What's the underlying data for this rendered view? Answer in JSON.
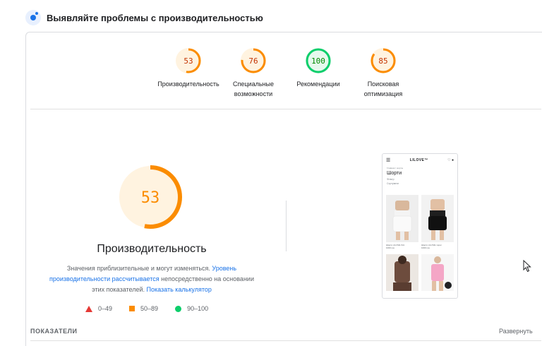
{
  "header": {
    "title": "Выявляйте проблемы с производительностью",
    "icon": "lighthouse-icon"
  },
  "categories": [
    {
      "score": "53",
      "label_line1": "Производительность",
      "label_line2": "",
      "color": "#fb8c00",
      "fraction": 0.53
    },
    {
      "score": "76",
      "label_line1": "Специальные",
      "label_line2": "возможности",
      "color": "#fb8c00",
      "fraction": 0.76
    },
    {
      "score": "100",
      "label_line1": "Рекомендации",
      "label_line2": "",
      "color": "#0cce6b",
      "fraction": 1.0
    },
    {
      "score": "85",
      "label_line1": "Поисковая",
      "label_line2": "оптимизация",
      "color": "#fb8c00",
      "fraction": 0.85
    }
  ],
  "main": {
    "score": "53",
    "fraction": 0.53,
    "title": "Производительность",
    "desc_1": "Значения приблизительные и могут изменяться. ",
    "desc_link1": "Уровень производительности рассчитывается",
    "desc_2": " непосредственно на основании этих показателей. ",
    "desc_link2": "Показать калькулятор"
  },
  "legend": {
    "poor": "0–49",
    "average": "50–89",
    "good": "90–100"
  },
  "metrics": {
    "label": "ПОКАЗАТЕЛИ",
    "expand": "Развернуть"
  },
  "phone": {
    "logo": "LILOVE™",
    "breadcrumb": "Главная / шорты",
    "title": "Шорти",
    "meta1": "Фільтр",
    "meta2": "Сортувати",
    "products": [
      {
        "caption": "Шорти LILOVE білі",
        "price": "1000 грн"
      },
      {
        "caption": "Шорти LILOVE чорні",
        "price": "1000 грн"
      },
      {
        "caption": "",
        "price": ""
      },
      {
        "caption": "",
        "price": ""
      }
    ]
  },
  "colors": {
    "orange": "#fb8c00",
    "green": "#0cce6b",
    "red": "#e53935",
    "link": "#1a73e8"
  }
}
